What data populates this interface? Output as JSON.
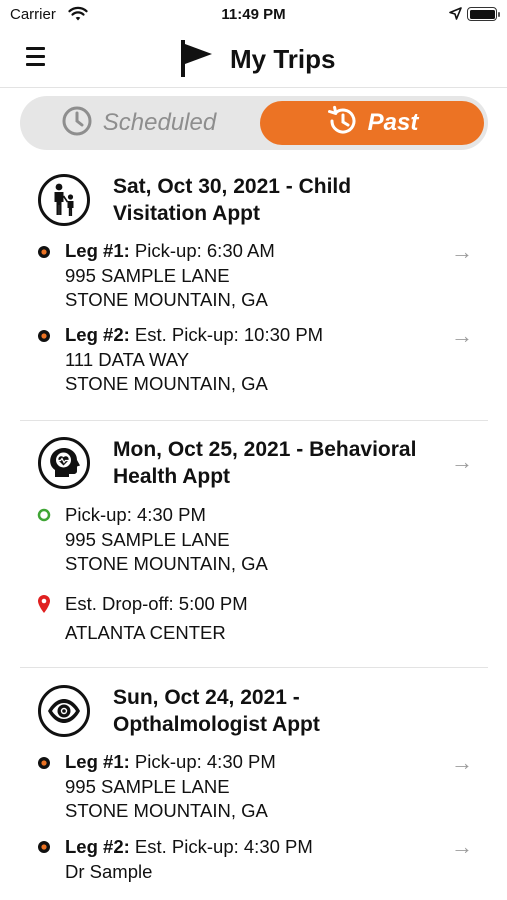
{
  "status_bar": {
    "carrier": "Carrier",
    "time": "11:49 PM",
    "icons": [
      "wifi-icon",
      "location-arrow-icon",
      "battery-icon"
    ]
  },
  "header": {
    "title": "My Trips",
    "menu_icon": "hamburger-menu-icon",
    "logo_icon": "flag-icon"
  },
  "tabs": {
    "scheduled": {
      "label": "Scheduled",
      "icon": "clock-icon",
      "selected": false
    },
    "past": {
      "label": "Past",
      "icon": "history-clock-icon",
      "selected": true
    }
  },
  "colors": {
    "accent": "#ec7324",
    "tab_track": "#e6e6e6",
    "muted_text": "#8e8e8e",
    "pickup_green": "#3fa535",
    "dropoff_red": "#e02020",
    "arrow_gray": "#9c9c9c"
  },
  "trips": [
    {
      "icon": "parent-child-icon",
      "title_line1": "Sat, Oct 30, 2021 - Child",
      "title_line2": "Visitation Appt",
      "legs": [
        {
          "label": "Leg #1:",
          "time": "Pick-up: 6:30 AM",
          "address1": "995 SAMPLE LANE",
          "address2": "STONE MOUNTAIN, GA"
        },
        {
          "label": "Leg #2:",
          "time": "Est. Pick-up: 10:30 PM",
          "address1": "111 DATA WAY",
          "address2": "STONE MOUNTAIN, GA"
        }
      ]
    },
    {
      "icon": "behavioral-health-head-icon",
      "title_line1": "Mon, Oct 25, 2021 - Behavioral",
      "title_line2": "Health Appt",
      "pickup": {
        "time": "Pick-up: 4:30 PM",
        "address1": "995 SAMPLE LANE",
        "address2": "STONE MOUNTAIN, GA"
      },
      "dropoff": {
        "time": "Est. Drop-off: 5:00 PM",
        "address1": "ATLANTA CENTER"
      }
    },
    {
      "icon": "eye-icon",
      "title_line1": "Sun, Oct 24, 2021 -",
      "title_line2": "Opthalmologist Appt",
      "legs": [
        {
          "label": "Leg #1:",
          "time": "Pick-up: 4:30 PM",
          "address1": "995 SAMPLE LANE",
          "address2": "STONE MOUNTAIN, GA"
        },
        {
          "label": "Leg #2:",
          "time": "Est. Pick-up: 4:30 PM",
          "address1": "Dr Sample"
        }
      ]
    }
  ],
  "row_arrow": "→"
}
